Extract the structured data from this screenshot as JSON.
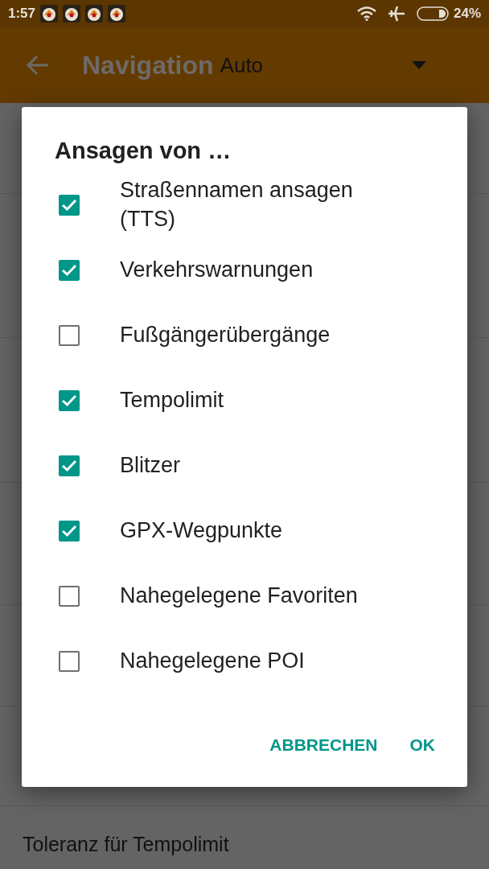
{
  "status_bar": {
    "time": "1:57",
    "battery": "24%"
  },
  "app_bar": {
    "title": "Navigation",
    "profile": "Auto"
  },
  "background_list": {
    "bottom_item": {
      "title": "Toleranz für Tempolimit"
    }
  },
  "dialog": {
    "title": "Ansagen von …",
    "options": [
      {
        "label": "Straßennamen ansagen (TTS)",
        "checked": true
      },
      {
        "label": "Verkehrswarnungen",
        "checked": true
      },
      {
        "label": "Fußgängerübergänge",
        "checked": false
      },
      {
        "label": "Tempolimit",
        "checked": true
      },
      {
        "label": "Blitzer",
        "checked": true
      },
      {
        "label": "GPX-Wegpunkte",
        "checked": true
      },
      {
        "label": "Nahegelegene Favoriten",
        "checked": false
      },
      {
        "label": "Nahegelegene POI",
        "checked": false
      }
    ],
    "buttons": [
      "ABBRECHEN",
      "OK"
    ]
  }
}
